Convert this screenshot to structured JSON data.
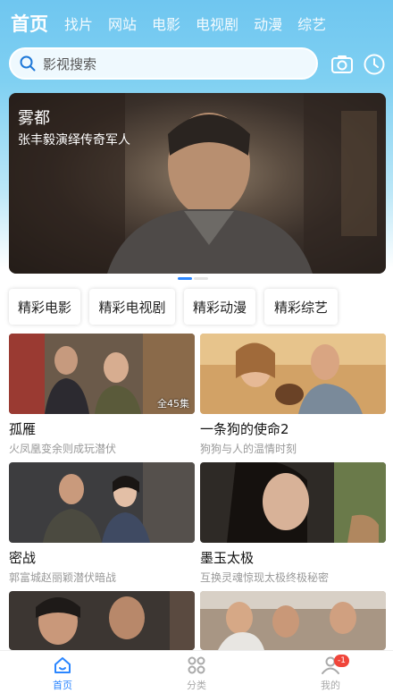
{
  "top_tabs": [
    "首页",
    "找片",
    "网站",
    "电影",
    "电视剧",
    "动漫",
    "综艺"
  ],
  "search": {
    "placeholder": "影视搜索",
    "icon": "search-icon"
  },
  "top_right_icons": [
    "camera-icon",
    "history-clock-icon"
  ],
  "banner": {
    "title": "雾都",
    "subtitle": "张丰毅演绎传奇军人",
    "slides": 2,
    "active_slide": 1
  },
  "chips": [
    "精彩电影",
    "精彩电视剧",
    "精彩动漫",
    "精彩综艺"
  ],
  "cards": [
    {
      "name": "孤雁",
      "desc": "火凤凰变余则成玩潜伏",
      "badge": "全45集"
    },
    {
      "name": "一条狗的使命2",
      "desc": "狗狗与人的温情时刻",
      "badge": ""
    },
    {
      "name": "密战",
      "desc": "郭富城赵丽颖潜伏暗战",
      "badge": ""
    },
    {
      "name": "墨玉太极",
      "desc": "互换灵魂惊现太极终极秘密",
      "badge": ""
    },
    {
      "name": "",
      "desc": "",
      "badge": ""
    },
    {
      "name": "",
      "desc": "",
      "badge": ""
    }
  ],
  "bottom_nav": [
    {
      "label": "首页",
      "icon": "home-icon",
      "active": true
    },
    {
      "label": "分类",
      "icon": "category-grid-icon",
      "active": false
    },
    {
      "label": "我的",
      "icon": "user-icon",
      "active": false,
      "badge": "-1"
    }
  ],
  "colors": {
    "accent": "#2b86ff",
    "header_top": "#6fc6f0",
    "badge_red": "#f0453a"
  }
}
